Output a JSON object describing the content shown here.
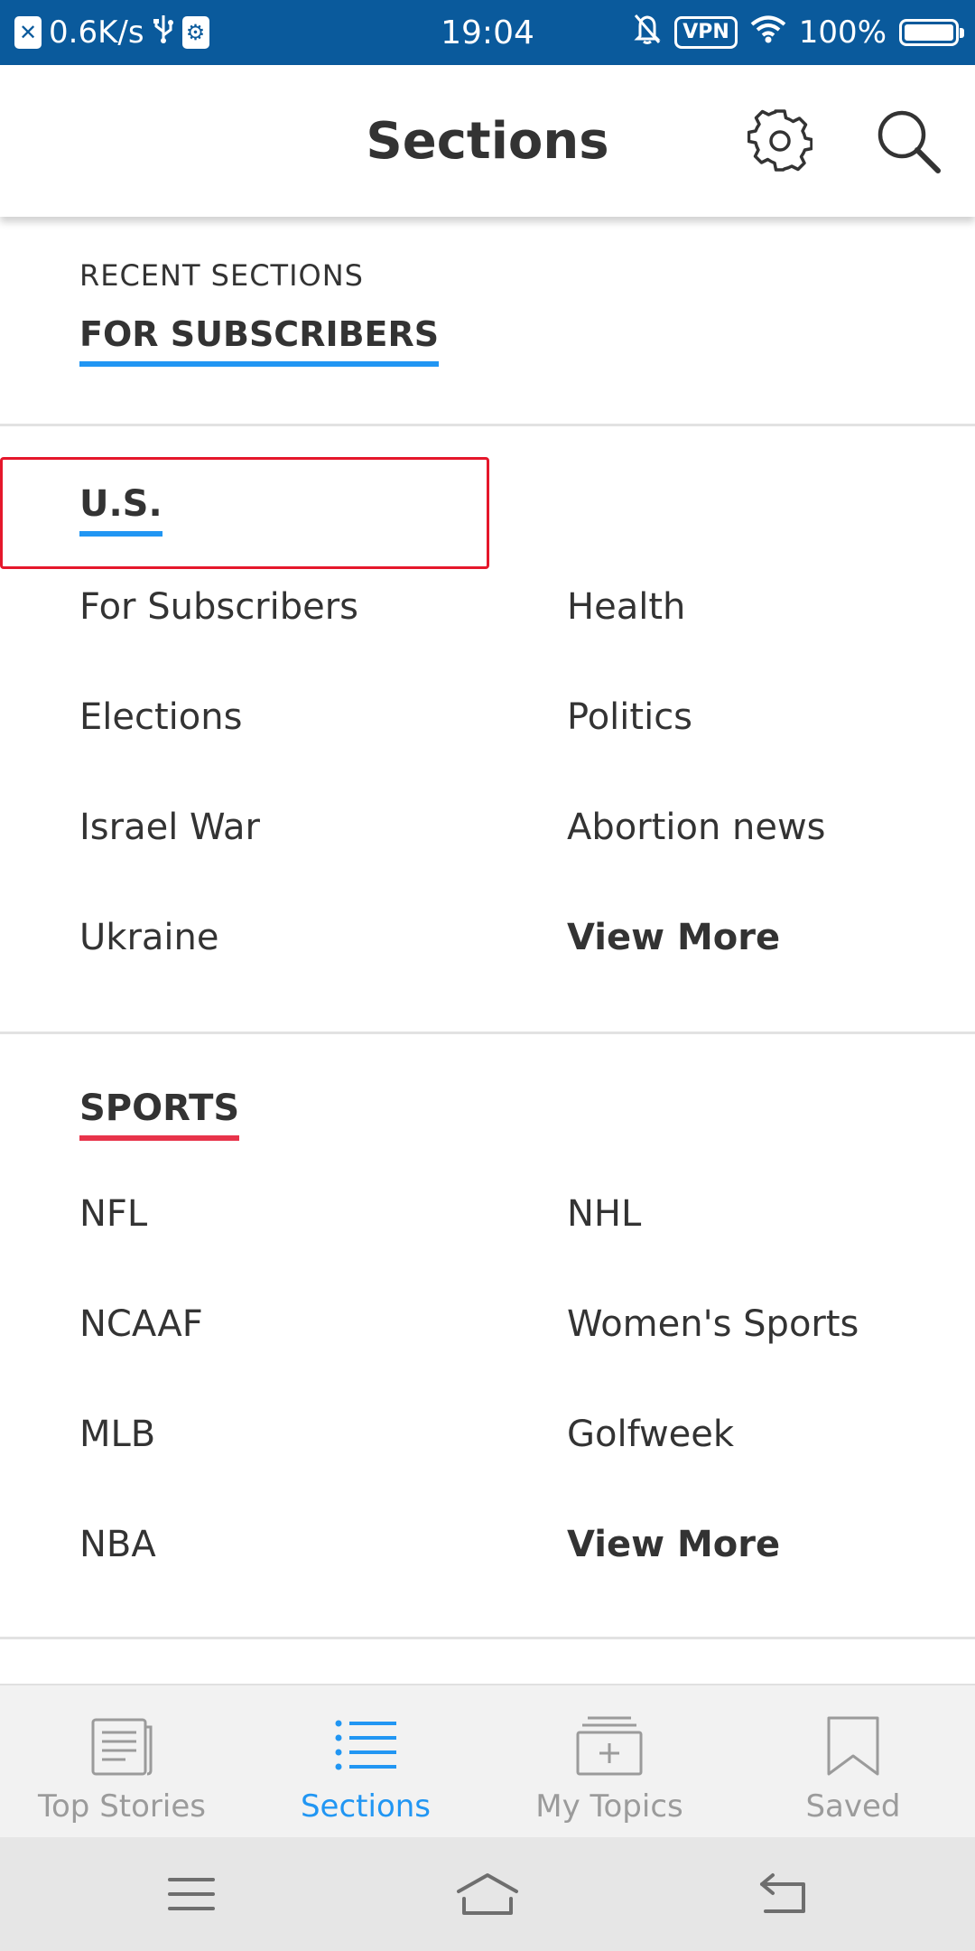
{
  "status_bar": {
    "network_speed": "0.6K/s",
    "time": "19:04",
    "vpn_label": "VPN",
    "battery_percent": "100%",
    "battery_level": 1.0
  },
  "header": {
    "title": "Sections",
    "settings_icon": "gear-icon",
    "search_icon": "search-icon"
  },
  "recent_sections": {
    "label": "RECENT SECTIONS",
    "items": [
      "FOR SUBSCRIBERS"
    ]
  },
  "sections": [
    {
      "heading": "U.S.",
      "accent_color": "#2196f3",
      "items": [
        "For Subscribers",
        "Health",
        "Elections",
        "Politics",
        "Israel War",
        "Abortion news",
        "Ukraine",
        "View More"
      ]
    },
    {
      "heading": "SPORTS",
      "accent_color": "#e8334a",
      "items": [
        "NFL",
        "NHL",
        "NCAAF",
        "Women's Sports",
        "MLB",
        "Golfweek",
        "NBA",
        "View More"
      ]
    }
  ],
  "bottom_nav": {
    "active": "Sections",
    "active_color": "#2196f3",
    "tabs": [
      {
        "label": "Top Stories",
        "icon": "newspaper-icon"
      },
      {
        "label": "Sections",
        "icon": "list-icon"
      },
      {
        "label": "My Topics",
        "icon": "add-topic-icon"
      },
      {
        "label": "Saved",
        "icon": "bookmark-icon"
      }
    ]
  },
  "system_nav": {
    "icons": [
      "menu-icon",
      "home-icon",
      "back-icon"
    ]
  },
  "highlight_color": "#e5172b"
}
